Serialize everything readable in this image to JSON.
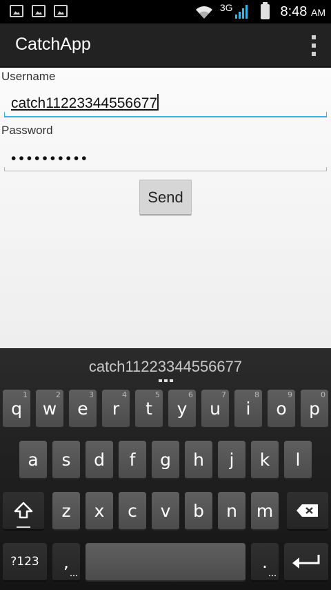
{
  "status_bar": {
    "network": "3G",
    "time": "8:48",
    "ampm": "AM",
    "icons": [
      "gallery-icon",
      "image-upload-icon",
      "image-upload-icon",
      "wifi-icon",
      "signal-icon",
      "battery-icon"
    ]
  },
  "action_bar": {
    "title": "CatchApp",
    "overflow_icon": "overflow-menu-icon"
  },
  "form": {
    "username_label": "Username",
    "username_value": "catch11223344556677",
    "password_label": "Password",
    "password_value": "••••••••••",
    "send_label": "Send"
  },
  "keyboard": {
    "suggestion": "catch11223344556677",
    "row1": [
      {
        "label": "q",
        "hint": "1"
      },
      {
        "label": "w",
        "hint": "2"
      },
      {
        "label": "e",
        "hint": "3"
      },
      {
        "label": "r",
        "hint": "4"
      },
      {
        "label": "t",
        "hint": "5"
      },
      {
        "label": "y",
        "hint": "6"
      },
      {
        "label": "u",
        "hint": "7"
      },
      {
        "label": "i",
        "hint": "8"
      },
      {
        "label": "o",
        "hint": "9"
      },
      {
        "label": "p",
        "hint": "0"
      }
    ],
    "row2": [
      "a",
      "s",
      "d",
      "f",
      "g",
      "h",
      "j",
      "k",
      "l"
    ],
    "row3": [
      "z",
      "x",
      "c",
      "v",
      "b",
      "n",
      "m"
    ],
    "symbols_label": "?123",
    "comma_label": ",",
    "period_label": ".",
    "shift_icon": "shift-icon",
    "backspace_icon": "backspace-icon",
    "enter_icon": "enter-icon"
  }
}
